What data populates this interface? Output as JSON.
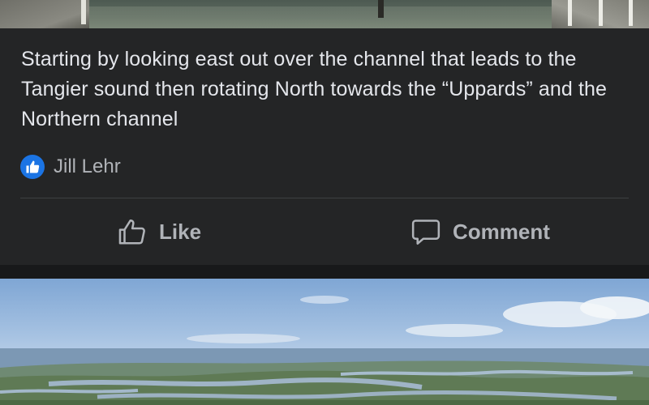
{
  "post": {
    "caption": "Starting by looking east out over the channel that leads to the Tangier sound then rotating North towards the “Uppards” and the Northern channel",
    "reactions": {
      "icon": "thumbs-up-icon",
      "names": "Jill Lehr"
    },
    "actions": {
      "like_label": "Like",
      "comment_label": "Comment"
    }
  },
  "colors": {
    "background": "#242526",
    "text_primary": "#e4e6eb",
    "text_secondary": "#b0b3b8",
    "like_blue": "#1b74e4"
  }
}
